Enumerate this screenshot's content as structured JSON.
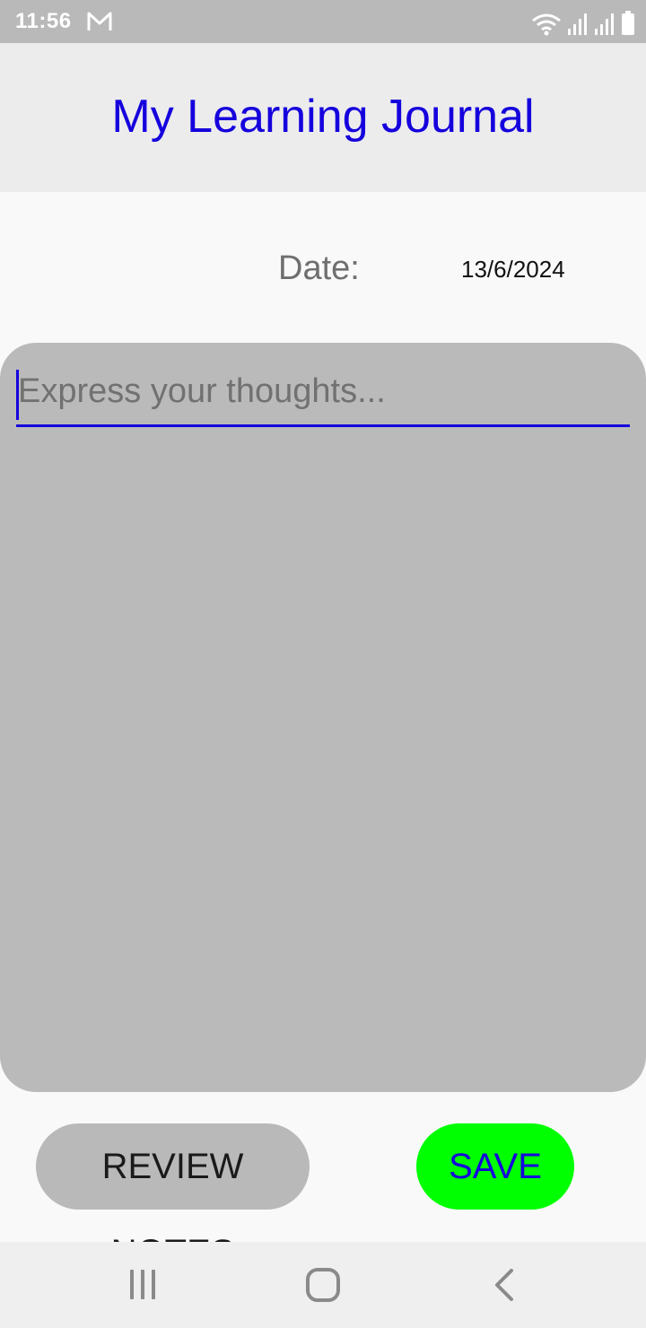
{
  "status_bar": {
    "time": "11:56"
  },
  "header": {
    "title": "My Learning Journal"
  },
  "date": {
    "label": "Date:",
    "value": "13/6/2024"
  },
  "journal": {
    "placeholder": "Express your thoughts...",
    "value": ""
  },
  "buttons": {
    "review_label": "REVIEW NOTES",
    "save_label": "SAVE"
  },
  "colors": {
    "accent": "#1500dd",
    "save_button": "#00ff00",
    "card": "#bababa",
    "status_bar": "#b9b9b9"
  },
  "icons": [
    "mail-icon",
    "wifi-icon",
    "signal-icon",
    "battery-icon",
    "recents-icon",
    "home-icon",
    "back-icon"
  ]
}
